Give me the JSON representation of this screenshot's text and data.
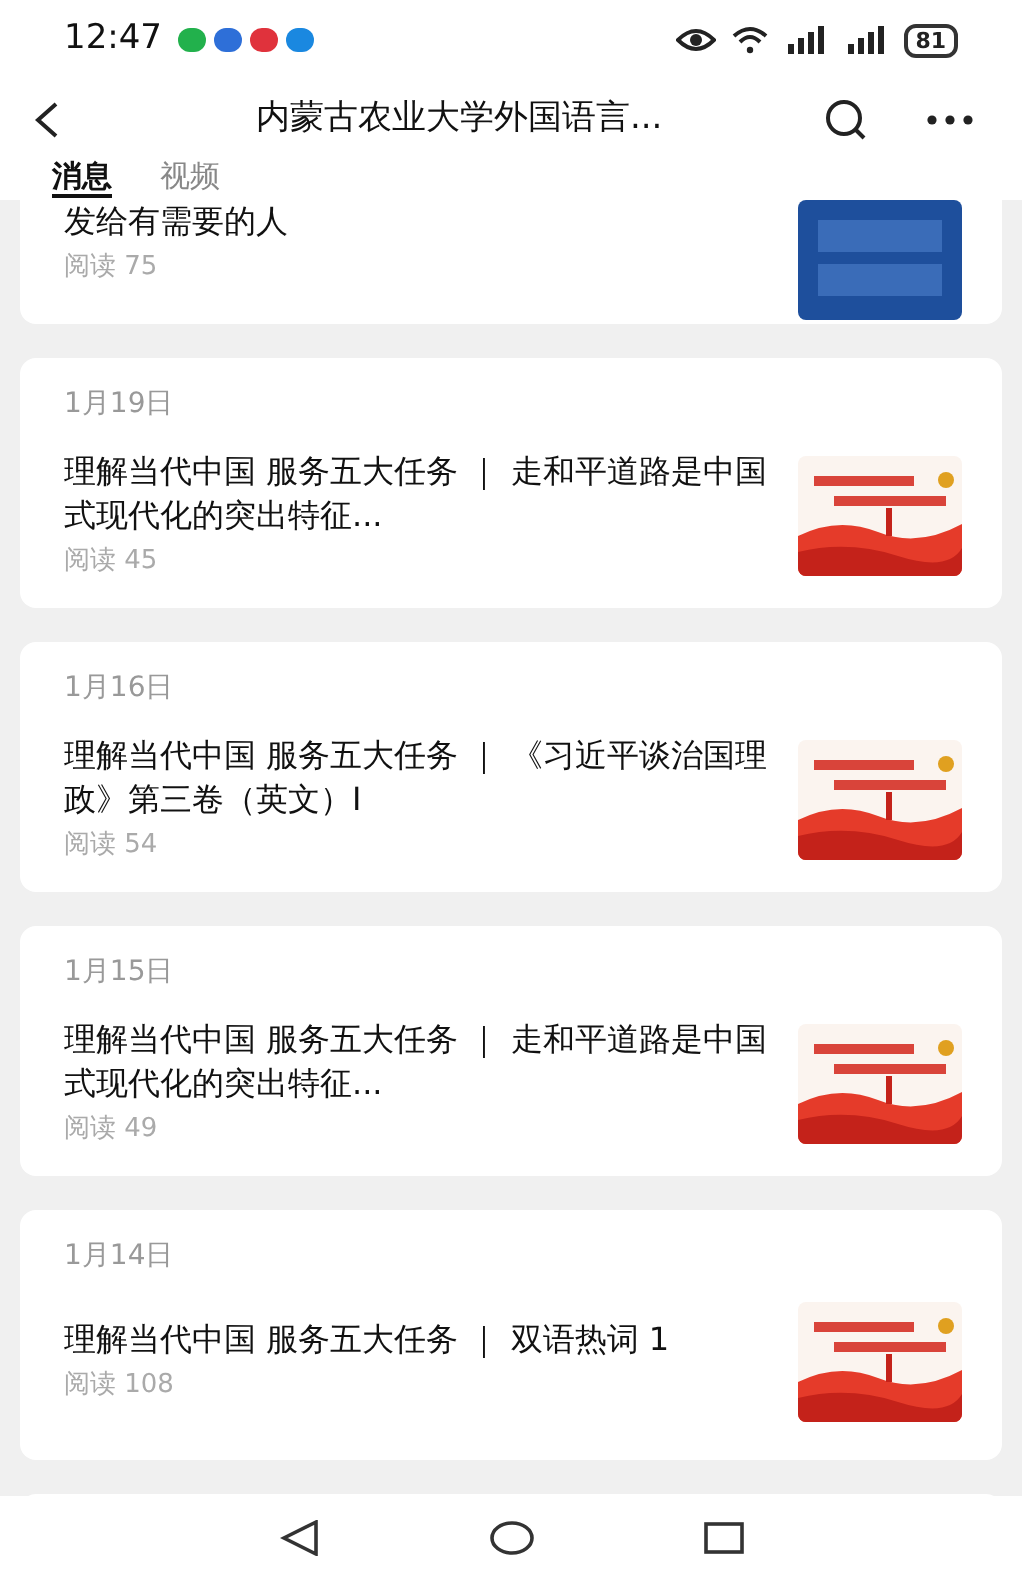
{
  "status_bar": {
    "time": "12:47",
    "battery": "81"
  },
  "header": {
    "title": "内蒙古农业大学外国语言..."
  },
  "tabs": [
    {
      "label": "消息",
      "selected": true
    },
    {
      "label": "视频",
      "selected": false
    }
  ],
  "articles": [
    {
      "title": "发给有需要的人",
      "reads": "阅读 75"
    },
    {
      "date": "1月19日",
      "title": "理解当代中国 服务五大任务 ｜ 走和平道路是中国式现代化的突出特征...",
      "reads": "阅读 45"
    },
    {
      "date": "1月16日",
      "title": "理解当代中国 服务五大任务 ｜ 《习近平谈治国理政》第三卷（英文）Ⅰ",
      "reads": "阅读 54"
    },
    {
      "date": "1月15日",
      "title": "理解当代中国 服务五大任务 ｜ 走和平道路是中国式现代化的突出特征...",
      "reads": "阅读 49"
    },
    {
      "date": "1月14日",
      "title": "理解当代中国 服务五大任务 ｜ 双语热词 1",
      "reads": "阅读 108"
    }
  ]
}
